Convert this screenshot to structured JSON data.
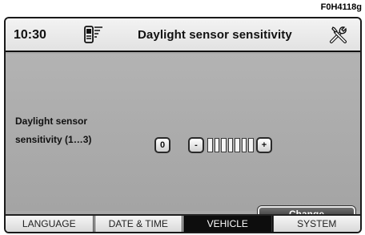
{
  "figure_code": "F0H4118g",
  "header": {
    "time": "10:30",
    "title": "Daylight sensor sensitivity",
    "phone_icon": "phone-signal-icon",
    "tools_icon": "tools-icon"
  },
  "setting": {
    "label_line1": "Daylight sensor",
    "label_line2": "sensitivity (1…3)",
    "zero_label": "0",
    "minus_label": "-",
    "plus_label": "+",
    "level_segments": 7
  },
  "actions": {
    "change_label": "Change"
  },
  "tabs": [
    {
      "label": "LANGUAGE",
      "active": false
    },
    {
      "label": "DATE & TIME",
      "active": false
    },
    {
      "label": "VEHICLE",
      "active": true
    },
    {
      "label": "SYSTEM",
      "active": false
    }
  ],
  "colors": {
    "active_tab": "#0d0d0d",
    "content_bg": "#a9a9a9"
  }
}
